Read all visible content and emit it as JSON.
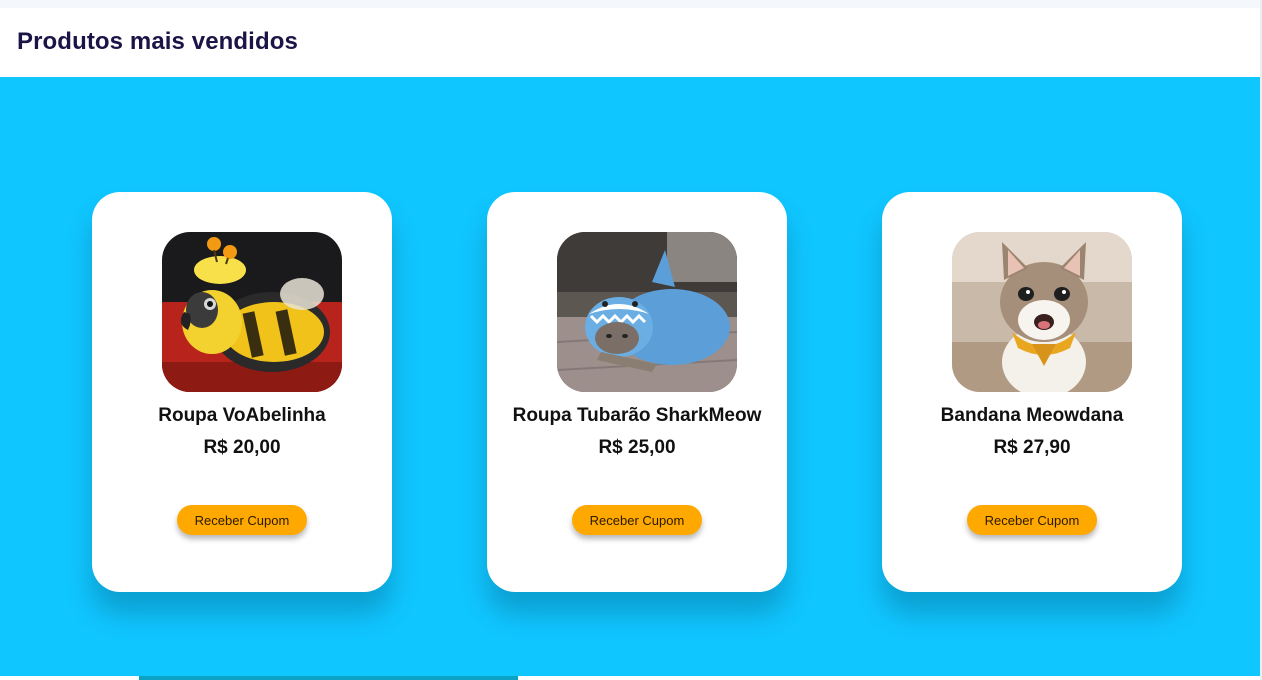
{
  "header": {
    "title": "Produtos mais vendidos"
  },
  "colors": {
    "section_bg": "#10c6ff",
    "button_bg": "#ffa800",
    "title_color": "#1b1447"
  },
  "products": [
    {
      "name": "Roupa VoAbelinha",
      "price": "R$ 20,00",
      "button_label": "Receber Cupom",
      "image": "bird-in-bee-costume"
    },
    {
      "name": "Roupa Tubarão SharkMeow",
      "price": "R$ 25,00",
      "button_label": "Receber Cupom",
      "image": "cat-in-shark-costume"
    },
    {
      "name": "Bandana Meowdana",
      "price": "R$ 27,90",
      "button_label": "Receber Cupom",
      "image": "cat-with-bandana"
    }
  ]
}
